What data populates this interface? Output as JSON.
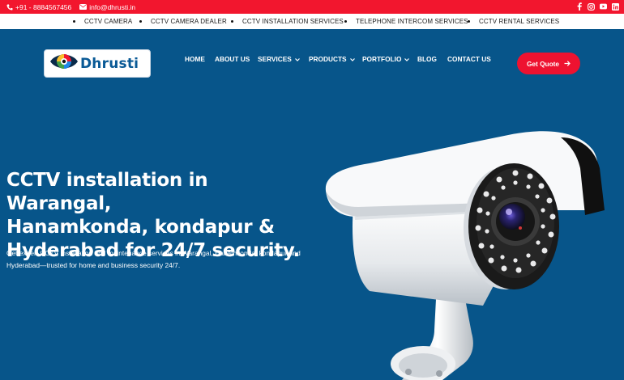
{
  "topbar": {
    "phone": "+91 - 8884567456",
    "email": "info@dhrusti.in",
    "social_icons": [
      "facebook-icon",
      "instagram-icon",
      "youtube-icon",
      "linkedin-icon"
    ],
    "color": "#f2162e"
  },
  "services_strip": [
    "CCTV CAMERA",
    "CCTV CAMERA DEALER",
    "CCTV INSTALLATION SERVICES",
    "TELEPHONE INTERCOM SERVICES",
    "CCTV RENTAL SERVICES"
  ],
  "logo": {
    "text": "Dhrusti"
  },
  "nav": {
    "items": [
      {
        "label": "HOME",
        "dropdown": false
      },
      {
        "label": "ABOUT US",
        "dropdown": false
      },
      {
        "label": "SERVICES",
        "dropdown": true
      },
      {
        "label": "PRODUCTS",
        "dropdown": true
      },
      {
        "label": "PORTFOLIO",
        "dropdown": true
      },
      {
        "label": "BLOG",
        "dropdown": false
      },
      {
        "label": "CONTACT US",
        "dropdown": false
      }
    ],
    "cta_label": "Get Quote"
  },
  "hero": {
    "title_lines": [
      "CCTV installation in Warangal,",
      "Hanamkonda, kondapur &",
      "Hyderabad for 24/7 security."
    ],
    "subtitle_lines": [
      "Get expert CCTV installation and maintenance services in Warangal, Hanamkonda, kondapur and",
      "Hyderabad—trusted for home and business security 24/7."
    ],
    "background": "#07558a"
  }
}
